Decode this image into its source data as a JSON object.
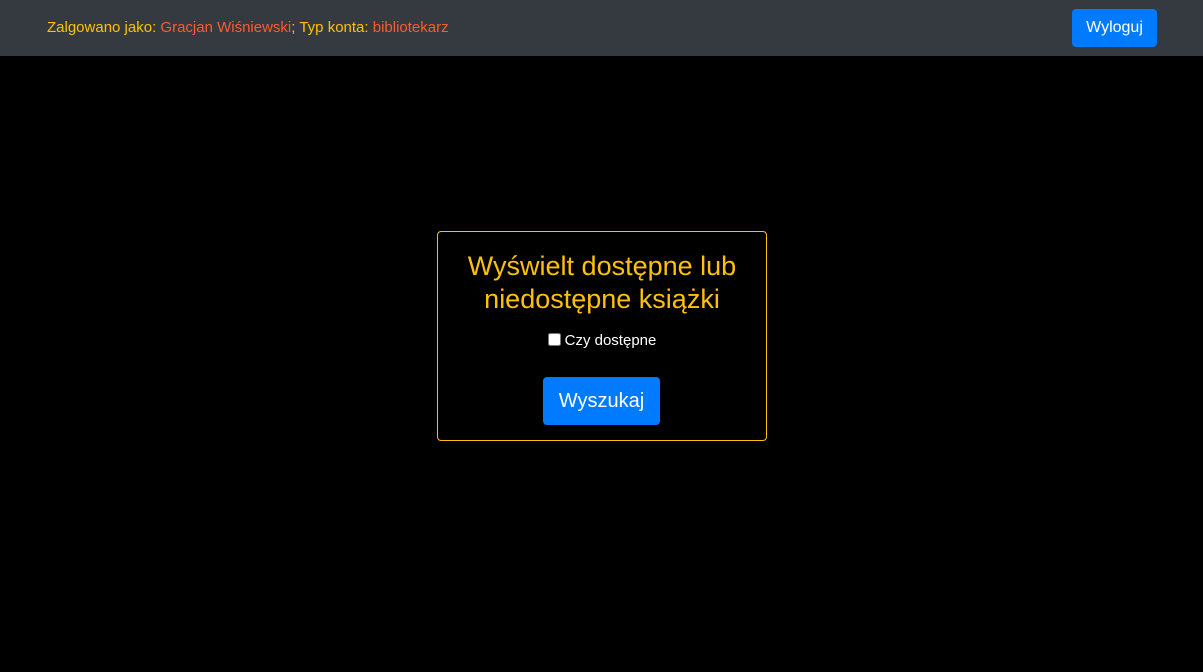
{
  "header": {
    "logged_in_label": "Zalgowano jako: ",
    "user_name": "Gracjan Wiśniewski",
    "account_type_label": "; Typ konta: ",
    "account_type": "bibliotekarz",
    "logout_label": "Wyloguj"
  },
  "search_form": {
    "title": "Wyświelt dostępne lub niedostępne książki",
    "available_checkbox_label": "Czy dostępne",
    "available_checked": false,
    "search_button_label": "Wyszukaj"
  },
  "colors": {
    "navbar_bg": "#343a40",
    "accent_yellow": "#ffc107",
    "accent_orange": "#fd5b2e",
    "button_blue": "#007bff",
    "page_bg": "#000000"
  }
}
